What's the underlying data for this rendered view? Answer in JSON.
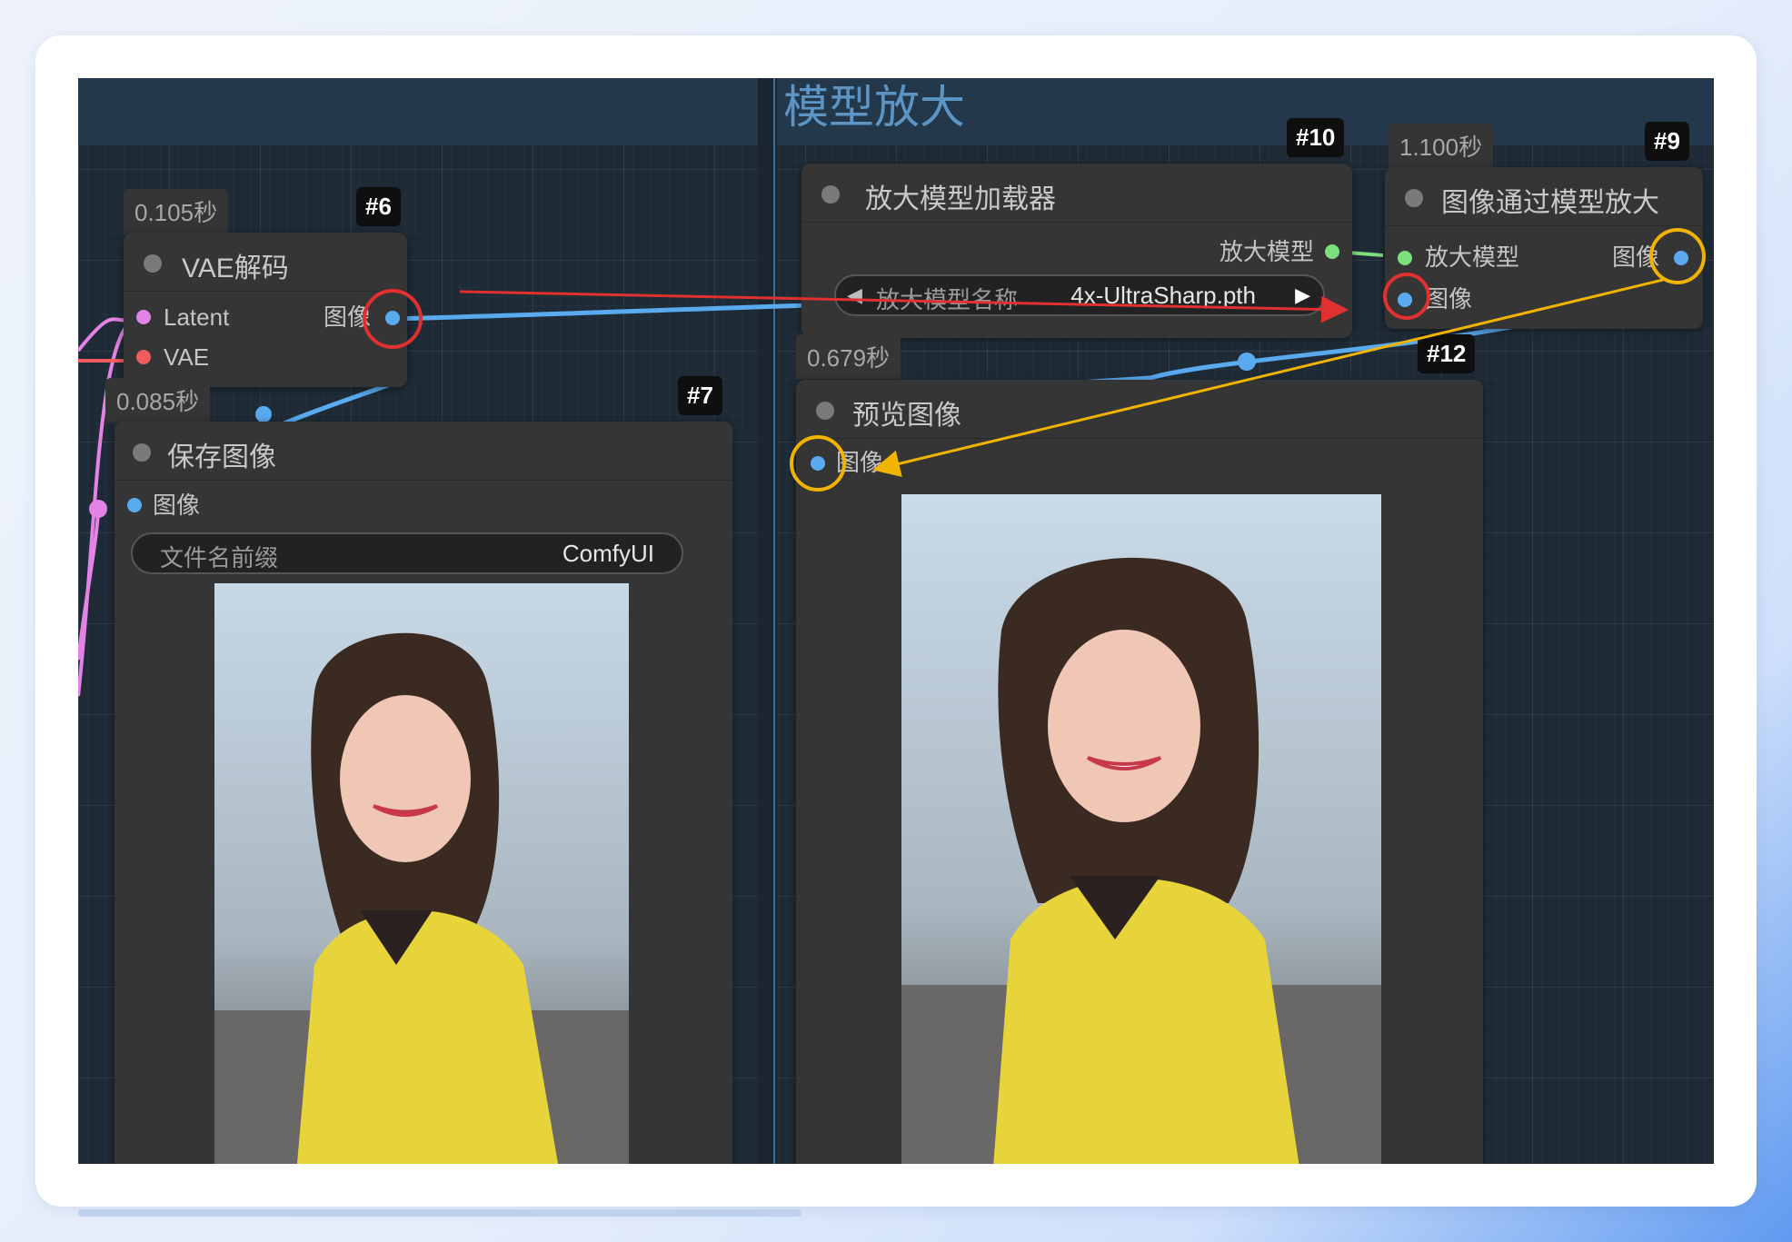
{
  "group": {
    "title": "模型放大"
  },
  "nodes": {
    "vae_decode": {
      "id": "#6",
      "timer": "0.105秒",
      "title": "VAE解码",
      "inputs": [
        "Latent",
        "VAE"
      ],
      "output": "图像"
    },
    "save_image": {
      "id": "#7",
      "timer": "0.085秒",
      "title": "保存图像",
      "input": "图像",
      "widget_label": "文件名前缀",
      "widget_value": "ComfyUI"
    },
    "upscale_loader": {
      "id": "#10",
      "title": "放大模型加载器",
      "output": "放大模型",
      "widget_label": "放大模型名称",
      "widget_value": "4x-UltraSharp.pth",
      "arrow_left": "◀",
      "arrow_right": "▶"
    },
    "upscale_with_model": {
      "id": "#9",
      "timer": "1.100秒",
      "title": "图像通过模型放大",
      "inputs": [
        "放大模型",
        "图像"
      ],
      "output": "图像"
    },
    "preview_image": {
      "id": "#12",
      "timer": "0.679秒",
      "title": "预览图像",
      "input": "图像"
    }
  },
  "colors": {
    "image_link": "#5aaaf0",
    "latent_link": "#e582e6",
    "vae_link": "#f25c5c",
    "model_link": "#7dde7d",
    "annotation_red": "#e03030",
    "annotation_yellow": "#f0b400"
  },
  "icons": [
    "node-status-dot",
    "photo-preview",
    "annotation-arrow"
  ]
}
